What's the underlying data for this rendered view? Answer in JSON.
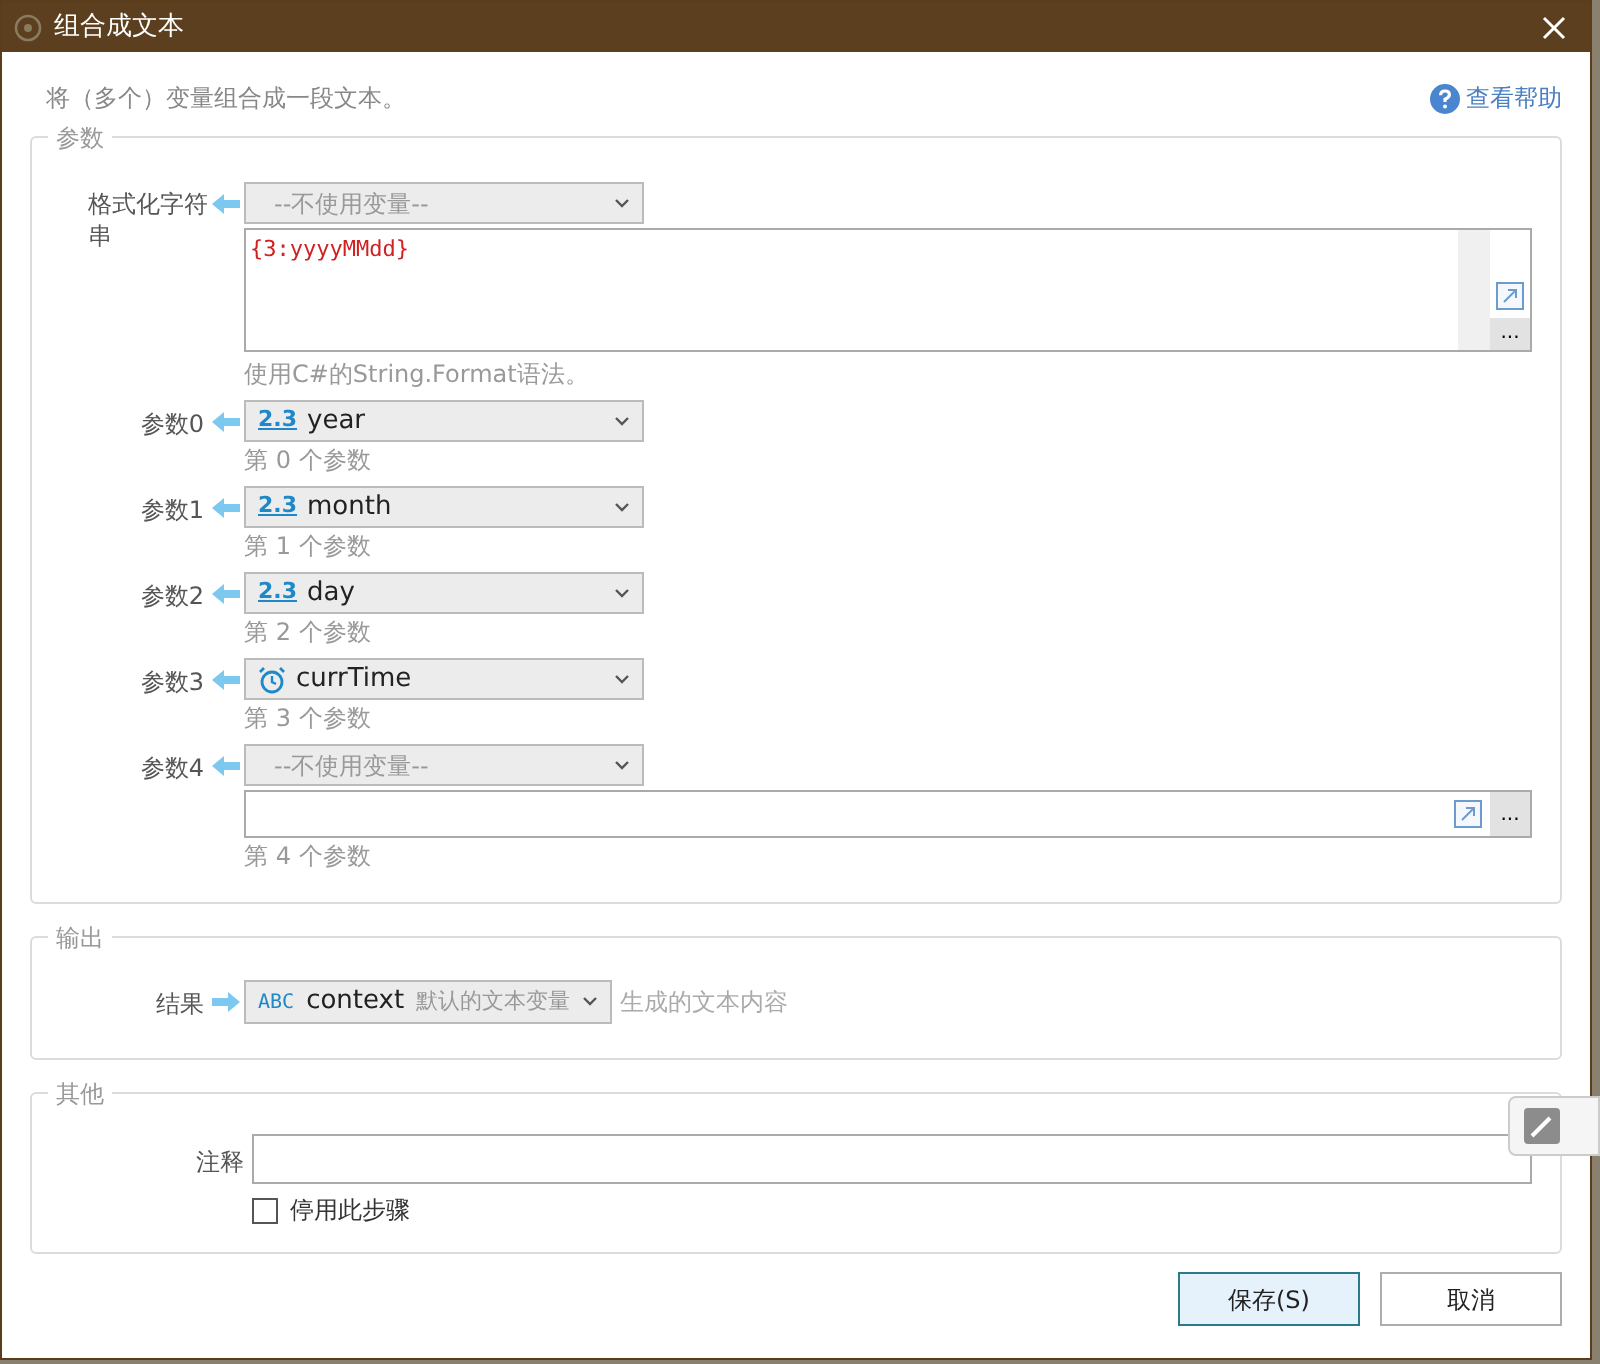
{
  "window": {
    "title": "组合成文本"
  },
  "description": "将（多个）变量组合成一段文本。",
  "help_link": "查看帮助",
  "parameters": {
    "legend": "参数",
    "format": {
      "label": "格式化字符串",
      "variable": "--不使用变量--",
      "value": "{3:yyyyMMdd}",
      "more_button": "...",
      "hint": "使用C#的String.Format语法。"
    },
    "items": [
      {
        "label": "参数0",
        "kind": "number",
        "badge": "2.3",
        "variable": "year",
        "hint": "第 0 个参数"
      },
      {
        "label": "参数1",
        "kind": "number",
        "badge": "2.3",
        "variable": "month",
        "hint": "第 1 个参数"
      },
      {
        "label": "参数2",
        "kind": "number",
        "badge": "2.3",
        "variable": "day",
        "hint": "第 2 个参数"
      },
      {
        "label": "参数3",
        "kind": "time",
        "variable": "currTime",
        "hint": "第 3 个参数"
      },
      {
        "label": "参数4",
        "kind": "unset",
        "variable": "--不使用变量--",
        "more_button": "...",
        "hint": "第 4 个参数"
      }
    ]
  },
  "output": {
    "legend": "输出",
    "label": "结果",
    "badge": "ABC",
    "variable": "context",
    "variable_note": "默认的文本变量",
    "hint": "生成的文本内容"
  },
  "other": {
    "legend": "其他",
    "comment_label": "注释",
    "disable_label": "停用此步骤",
    "disabled": false
  },
  "buttons": [
    {
      "label": "保存(S)",
      "kind": "primary"
    },
    {
      "label": "取消",
      "kind": "normal"
    }
  ]
}
